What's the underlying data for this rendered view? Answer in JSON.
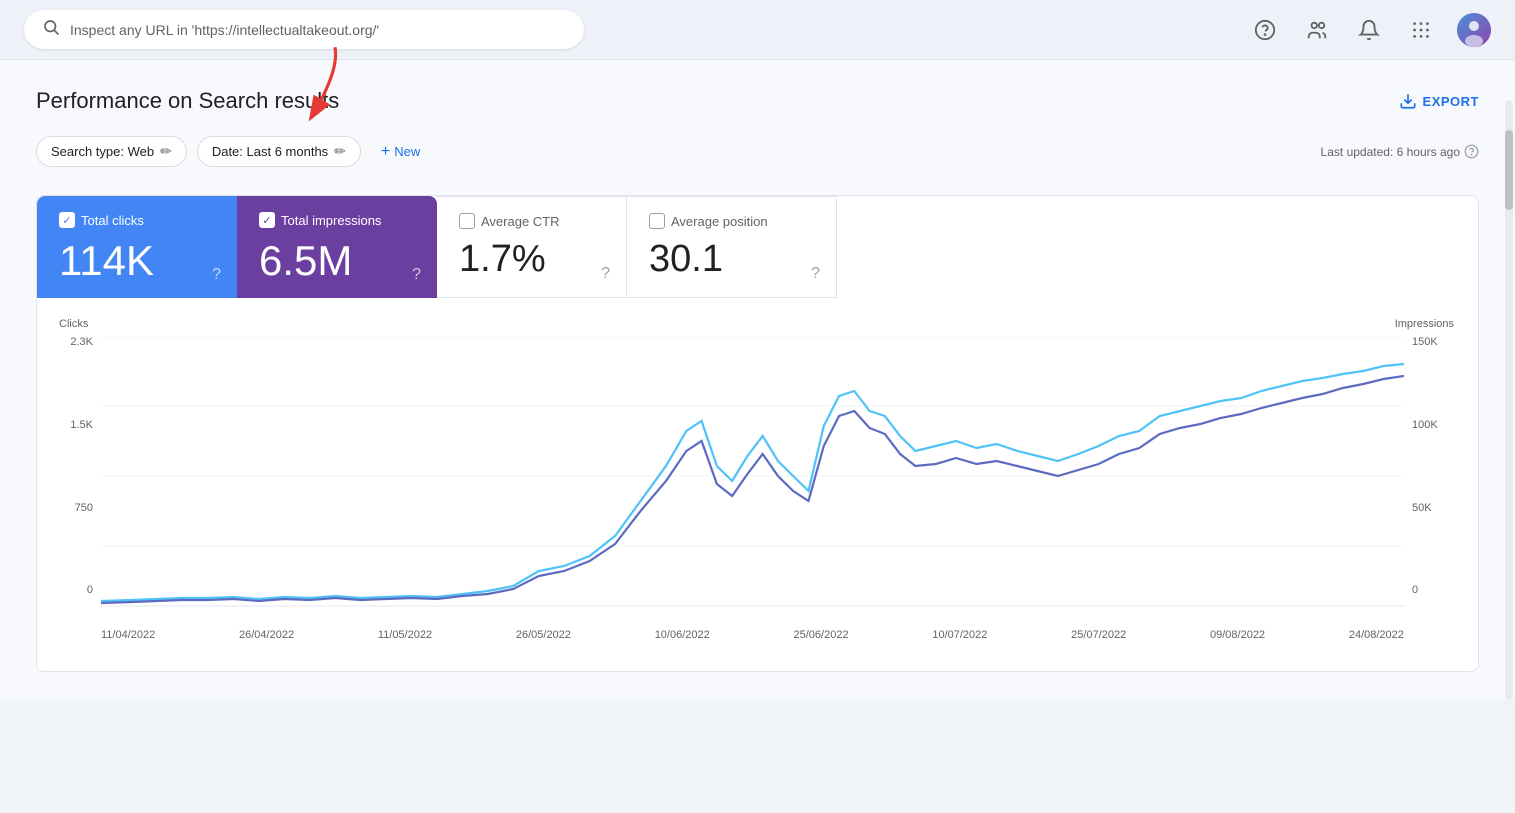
{
  "header": {
    "search_placeholder": "Inspect any URL in 'https://intellectualtakeout.org/'",
    "icons": [
      "help-icon",
      "people-icon",
      "bell-icon",
      "grid-icon",
      "avatar-icon"
    ]
  },
  "page": {
    "title": "Performance on Search results",
    "export_label": "EXPORT"
  },
  "filters": {
    "search_type_label": "Search type: Web",
    "date_label": "Date: Last 6 months",
    "new_label": "New",
    "last_updated": "Last updated: 6 hours ago"
  },
  "metrics": [
    {
      "id": "total-clicks",
      "label": "Total clicks",
      "value": "114K",
      "active": true,
      "color": "blue",
      "checked": true
    },
    {
      "id": "total-impressions",
      "label": "Total impressions",
      "value": "6.5M",
      "active": true,
      "color": "purple",
      "checked": true
    },
    {
      "id": "average-ctr",
      "label": "Average CTR",
      "value": "1.7%",
      "active": false,
      "color": "none",
      "checked": false
    },
    {
      "id": "average-position",
      "label": "Average position",
      "value": "30.1",
      "active": false,
      "color": "none",
      "checked": false
    }
  ],
  "chart": {
    "left_axis_title": "Clicks",
    "right_axis_title": "Impressions",
    "left_axis_values": [
      "2.3K",
      "1.5K",
      "750",
      "0"
    ],
    "right_axis_values": [
      "150K",
      "100K",
      "50K",
      "0"
    ],
    "x_labels": [
      "11/04/2022",
      "26/04/2022",
      "11/05/2022",
      "26/05/2022",
      "10/06/2022",
      "25/06/2022",
      "10/07/2022",
      "25/07/2022",
      "09/08/2022",
      "24/08/2022"
    ]
  }
}
